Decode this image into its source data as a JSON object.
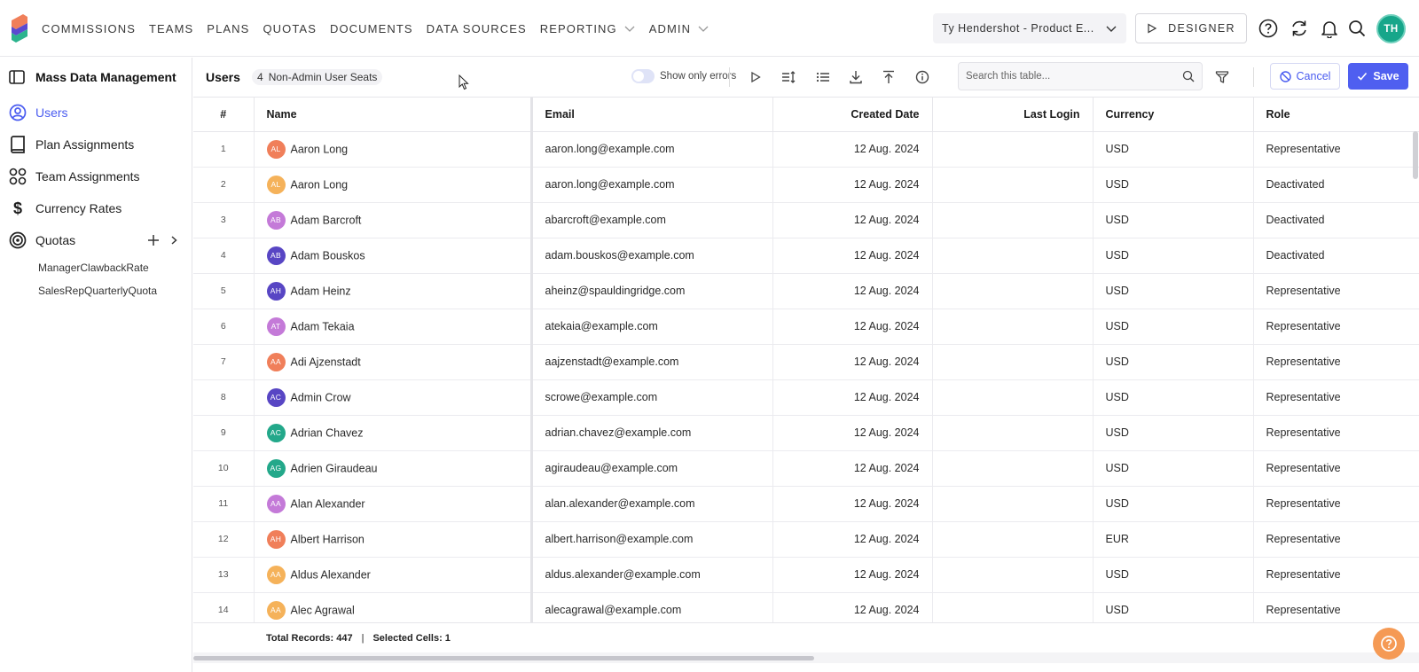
{
  "nav": {
    "items": [
      "COMMISSIONS",
      "TEAMS",
      "PLANS",
      "QUOTAS",
      "DOCUMENTS",
      "DATA SOURCES",
      "REPORTING",
      "ADMIN"
    ],
    "user_select": "Ty Hendershot - Product E...",
    "designer_label": "DESIGNER",
    "avatar_initials": "TH"
  },
  "sidebar": {
    "title": "Mass Data Management",
    "items": [
      {
        "label": "Users",
        "icon": "user-circle-icon"
      },
      {
        "label": "Plan Assignments",
        "icon": "book-icon"
      },
      {
        "label": "Team Assignments",
        "icon": "four-circles-icon"
      },
      {
        "label": "Currency Rates",
        "icon": "dollar-icon"
      },
      {
        "label": "Quotas",
        "icon": "target-icon"
      }
    ],
    "sub_items": [
      "ManagerClawbackRate",
      "SalesRepQuarterlyQuota"
    ]
  },
  "toolbar": {
    "title": "Users",
    "badge_count": "4",
    "badge_label": "Non-Admin User Seats",
    "toggle_label": "Show only errors",
    "search_placeholder": "Search this table...",
    "cancel_label": "Cancel",
    "save_label": "Save"
  },
  "table": {
    "columns": [
      "#",
      "Name",
      "Email",
      "Created Date",
      "Last Login",
      "Currency",
      "Role"
    ],
    "rows": [
      {
        "n": "1",
        "initials": "AL",
        "color": "#f07f5a",
        "name": "Aaron Long",
        "email": "aaron.long@example.com",
        "created": "12 Aug. 2024",
        "last_login": "",
        "currency": "USD",
        "role": "Representative"
      },
      {
        "n": "2",
        "initials": "AL",
        "color": "#f5b25a",
        "name": "Aaron Long",
        "email": "aaron.long@example.com",
        "created": "12 Aug. 2024",
        "last_login": "",
        "currency": "USD",
        "role": "Deactivated"
      },
      {
        "n": "3",
        "initials": "AB",
        "color": "#c47ad8",
        "name": "Adam Barcroft",
        "email": "abarcroft@example.com",
        "created": "12 Aug. 2024",
        "last_login": "",
        "currency": "USD",
        "role": "Deactivated"
      },
      {
        "n": "4",
        "initials": "AB",
        "color": "#5846c4",
        "name": "Adam Bouskos",
        "email": "adam.bouskos@example.com",
        "created": "12 Aug. 2024",
        "last_login": "",
        "currency": "USD",
        "role": "Deactivated"
      },
      {
        "n": "5",
        "initials": "AH",
        "color": "#5846c4",
        "name": "Adam Heinz",
        "email": "aheinz@spauldingridge.com",
        "created": "12 Aug. 2024",
        "last_login": "",
        "currency": "USD",
        "role": "Representative"
      },
      {
        "n": "6",
        "initials": "AT",
        "color": "#c47ad8",
        "name": "Adam Tekaia",
        "email": "atekaia@example.com",
        "created": "12 Aug. 2024",
        "last_login": "",
        "currency": "USD",
        "role": "Representative"
      },
      {
        "n": "7",
        "initials": "AA",
        "color": "#f07f5a",
        "name": "Adi Ajzenstadt",
        "email": "aajzenstadt@example.com",
        "created": "12 Aug. 2024",
        "last_login": "",
        "currency": "USD",
        "role": "Representative"
      },
      {
        "n": "8",
        "initials": "AC",
        "color": "#5846c4",
        "name": "Admin Crow",
        "email": "scrowe@example.com",
        "created": "12 Aug. 2024",
        "last_login": "",
        "currency": "USD",
        "role": "Representative"
      },
      {
        "n": "9",
        "initials": "AC",
        "color": "#23a88a",
        "name": "Adrian Chavez",
        "email": "adrian.chavez@example.com",
        "created": "12 Aug. 2024",
        "last_login": "",
        "currency": "USD",
        "role": "Representative"
      },
      {
        "n": "10",
        "initials": "AG",
        "color": "#23a88a",
        "name": "Adrien Giraudeau",
        "email": "agiraudeau@example.com",
        "created": "12 Aug. 2024",
        "last_login": "",
        "currency": "USD",
        "role": "Representative"
      },
      {
        "n": "11",
        "initials": "AA",
        "color": "#c47ad8",
        "name": "Alan Alexander",
        "email": "alan.alexander@example.com",
        "created": "12 Aug. 2024",
        "last_login": "",
        "currency": "USD",
        "role": "Representative"
      },
      {
        "n": "12",
        "initials": "AH",
        "color": "#f07f5a",
        "name": "Albert Harrison",
        "email": "albert.harrison@example.com",
        "created": "12 Aug. 2024",
        "last_login": "",
        "currency": "EUR",
        "role": "Representative"
      },
      {
        "n": "13",
        "initials": "AA",
        "color": "#f5b25a",
        "name": "Aldus Alexander",
        "email": "aldus.alexander@example.com",
        "created": "12 Aug. 2024",
        "last_login": "",
        "currency": "USD",
        "role": "Representative"
      },
      {
        "n": "14",
        "initials": "AA",
        "color": "#f5b25a",
        "name": "Alec Agrawal",
        "email": "alecagrawal@example.com",
        "created": "12 Aug. 2024",
        "last_login": "",
        "currency": "USD",
        "role": "Representative"
      }
    ]
  },
  "footer": {
    "total_records": "Total Records: 447",
    "separator": "|",
    "selected_cells": "Selected Cells: 1"
  },
  "colors": {
    "accent": "#4f5ff0",
    "help_fab": "#f59a55"
  }
}
